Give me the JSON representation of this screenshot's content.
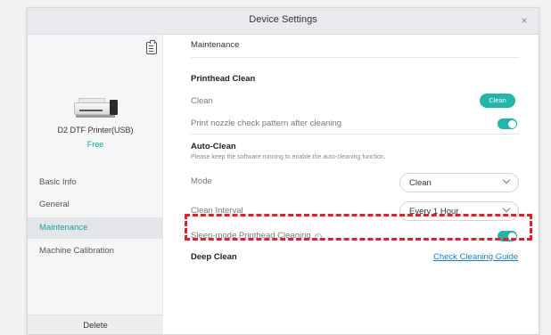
{
  "window": {
    "title": "Device Settings",
    "close_glyph": "×"
  },
  "sidebar": {
    "device_name": "D2 DTF Printer(USB)",
    "device_status": "Free",
    "items": [
      {
        "label": "Basic Info",
        "active": false
      },
      {
        "label": "General",
        "active": false
      },
      {
        "label": "Maintenance",
        "active": true
      },
      {
        "label": "Machine Calibration",
        "active": false
      }
    ],
    "delete_label": "Delete"
  },
  "content": {
    "section_title": "Maintenance",
    "printhead_clean": {
      "heading": "Printhead Clean",
      "clean_label": "Clean",
      "clean_button": "Clean",
      "nozzle_label": "Print nozzle check pattern after cleaning",
      "nozzle_enabled": true
    },
    "auto_clean": {
      "heading": "Auto-Clean",
      "note": "Please keep the software running to enable the auto-cleaning function.",
      "mode_label": "Mode",
      "mode_value": "Clean",
      "interval_label": "Clean Interval",
      "interval_value": "Every 1 Hour",
      "sleep_label": "Sleep-mode Printhead Cleaning",
      "sleep_enabled": true
    },
    "deep_clean": {
      "heading": "Deep Clean",
      "guide_link": "Check Cleaning Guide"
    }
  },
  "colors": {
    "accent": "#22b5a8",
    "active_nav": "#1aa39a",
    "link": "#1a7fc8",
    "highlight": "#e0202a"
  }
}
